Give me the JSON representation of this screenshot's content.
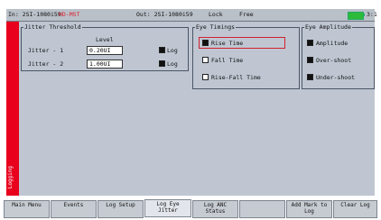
{
  "status": {
    "input_label": "In: 2SI-1080i59",
    "hd_badge": "HD-MST",
    "output_label": "Out: 2SI-1080i59",
    "lock": "Lock",
    "ref": "Free",
    "time": "3:1"
  },
  "side_label": "Logging",
  "jitter_threshold": {
    "title": "Jitter Threshold",
    "level_header": "Level",
    "rows": [
      {
        "label": "Jitter - 1",
        "value": "0.20UI",
        "log_label": "Log",
        "checked": true
      },
      {
        "label": "Jitter - 2",
        "value": "1.00UI",
        "log_label": "Log",
        "checked": true
      }
    ]
  },
  "eye_timings": {
    "title": "Eye Timings",
    "items": [
      {
        "label": "Rise Time",
        "checked": true
      },
      {
        "label": "Fall Time",
        "checked": false
      },
      {
        "label": "Rise-Fall Time",
        "checked": false
      }
    ]
  },
  "eye_amplitude": {
    "title": "Eye Amplitude",
    "items": [
      {
        "label": "Amplitude",
        "checked": true
      },
      {
        "label": "Over-shoot",
        "checked": true
      },
      {
        "label": "Under-shoot",
        "checked": true
      }
    ]
  },
  "softkeys": [
    {
      "label": "Main Menu"
    },
    {
      "label": "Events"
    },
    {
      "label": "Log Setup"
    },
    {
      "label": "Log Eye Jitter"
    },
    {
      "label": "Log ANC Status"
    },
    {
      "label": ""
    },
    {
      "label": "Add Mark to Log"
    },
    {
      "label": "Clear Log"
    }
  ]
}
